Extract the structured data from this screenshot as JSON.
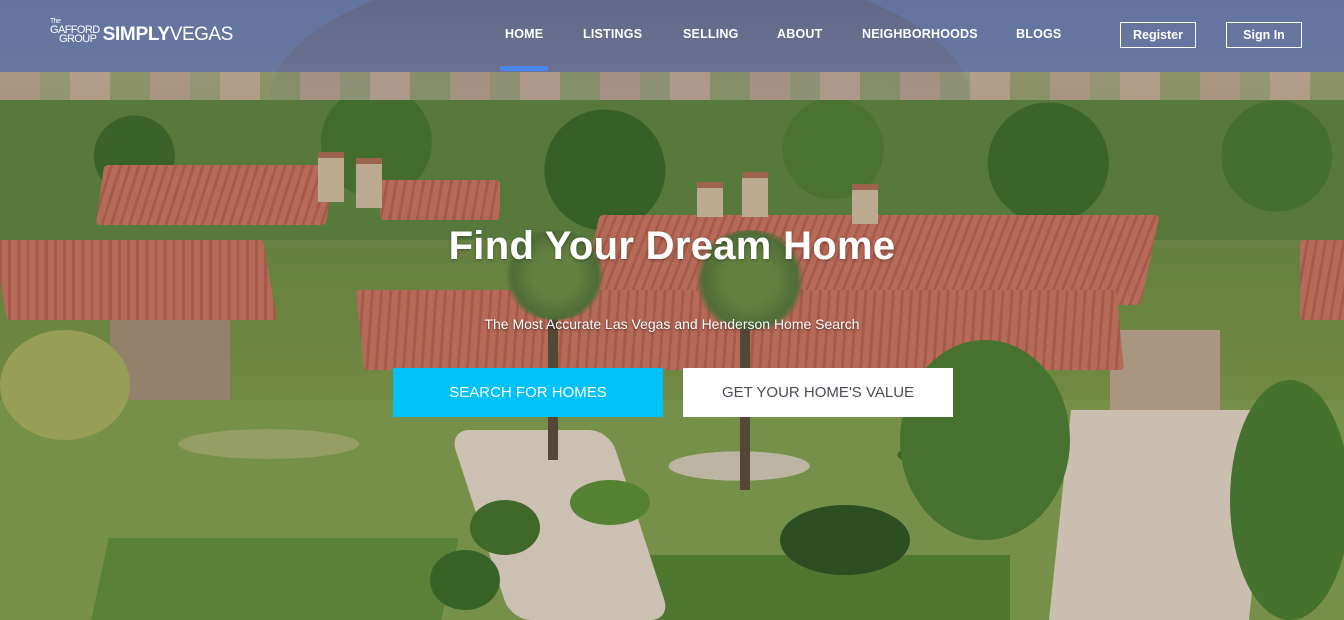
{
  "brand": {
    "the": "The",
    "gafford": "GAFFORD",
    "group": "GROUP",
    "simply": "SIMPLY",
    "vegas": "VEGAS"
  },
  "nav": {
    "items": [
      {
        "label": "HOME",
        "active": true
      },
      {
        "label": "LISTINGS",
        "active": false
      },
      {
        "label": "SELLING",
        "active": false
      },
      {
        "label": "ABOUT",
        "active": false
      },
      {
        "label": "NEIGHBORHOODS",
        "active": false
      },
      {
        "label": "BLOGS",
        "active": false
      }
    ],
    "active_indicator_color": "#4a86f0"
  },
  "auth": {
    "register_label": "Register",
    "signin_label": "Sign In"
  },
  "hero": {
    "title": "Find Your Dream Home",
    "subtitle": "The Most Accurate Las Vegas and Henderson Home Search",
    "background": "aerial-photo-luxury-home-las-vegas",
    "primary_cta": {
      "label": "SEARCH FOR HOMES",
      "color": "#00c2f8"
    },
    "secondary_cta": {
      "label": "GET YOUR HOME'S VALUE",
      "color": "#ffffff"
    }
  }
}
